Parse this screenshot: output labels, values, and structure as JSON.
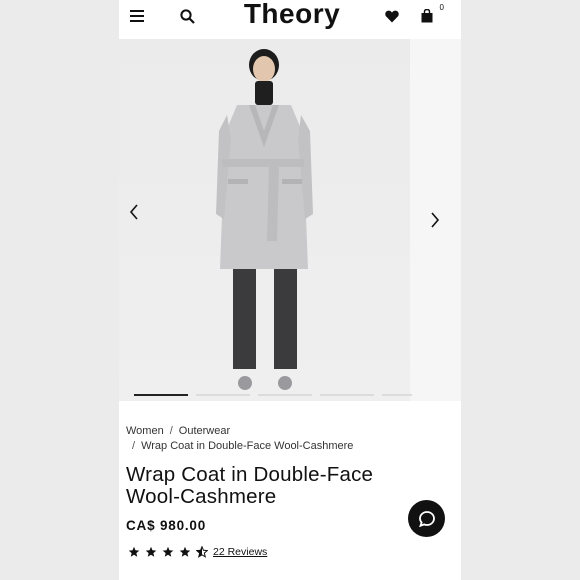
{
  "header": {
    "brand": "Theory",
    "bag_count": "0",
    "icons": [
      "menu-icon",
      "search-icon",
      "heart-icon",
      "bag-icon"
    ]
  },
  "gallery": {
    "slide_count": 5,
    "active_slide": 1,
    "icons": [
      "chevron-left-icon",
      "chevron-right-icon"
    ]
  },
  "breadcrumb": {
    "items": [
      "Women",
      "Outerwear",
      "Wrap Coat in Double-Face Wool-Cashmere"
    ],
    "separator": "/"
  },
  "product": {
    "title_line1": "Wrap Coat in Double-Face",
    "title_line2": "Wool-Cashmere",
    "price": "CA$ 980.00",
    "rating": 4.5,
    "reviews_label": "22 Reviews"
  },
  "chat": {
    "icon": "chat-icon"
  },
  "colors": {
    "page_bg": "#ebebeb",
    "coat": "#c9c9cb",
    "trousers": "#3b3b3d",
    "text": "#111111"
  }
}
